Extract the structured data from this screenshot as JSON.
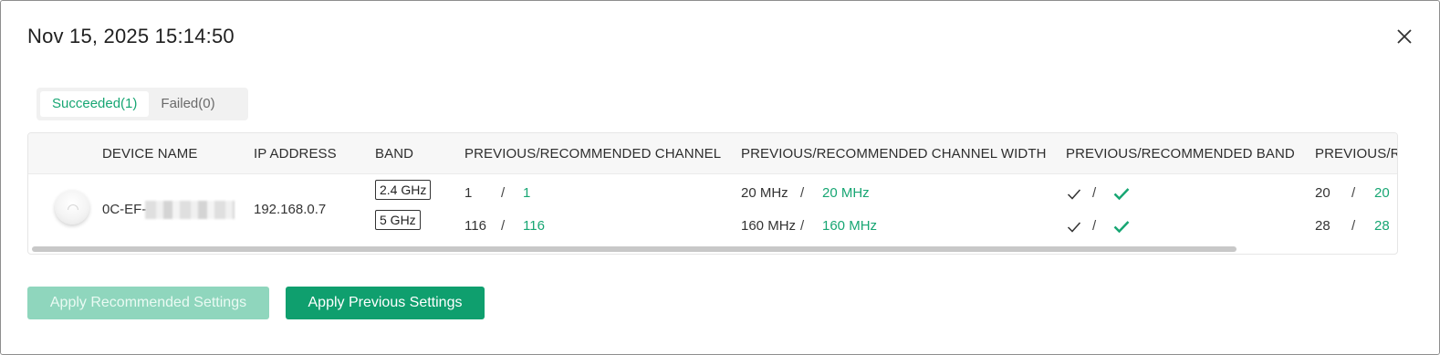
{
  "dialog": {
    "title": "Nov 15, 2025 15:14:50",
    "close_icon": "close-icon"
  },
  "tabs": [
    {
      "label": "Succeeded(1)",
      "active": true
    },
    {
      "label": "Failed(0)",
      "active": false
    }
  ],
  "table": {
    "headers": [
      "DEVICE NAME",
      "IP ADDRESS",
      "BAND",
      "PREVIOUS/RECOMMENDED CHANNEL",
      "PREVIOUS/RECOMMENDED CHANNEL WIDTH",
      "PREVIOUS/RECOMMENDED BAND",
      "PREVIOUS/R"
    ],
    "row": {
      "device_name_prefix": "0C-EF-",
      "ip_address": "192.168.0.7",
      "bands": [
        "2.4 GHz",
        "5 GHz"
      ],
      "channel": [
        {
          "previous": "1",
          "recommended": "1"
        },
        {
          "previous": "116",
          "recommended": "116"
        }
      ],
      "channel_width": [
        {
          "previous": "20 MHz",
          "recommended": "20 MHz"
        },
        {
          "previous": "160 MHz",
          "recommended": "160 MHz"
        }
      ],
      "band_status": [
        {
          "previous": "check-icon",
          "recommended": "check-icon-green"
        },
        {
          "previous": "check-icon",
          "recommended": "check-icon-green"
        }
      ],
      "last_col": [
        {
          "previous": "20",
          "recommended": "20"
        },
        {
          "previous": "28",
          "recommended": "28"
        }
      ],
      "separator": "/"
    }
  },
  "buttons": {
    "apply_recommended": "Apply Recommended Settings",
    "apply_previous": "Apply Previous Settings"
  },
  "colors": {
    "accent": "#17a673",
    "primary_button": "#0f9f6e",
    "disabled_button": "#8fd6bd"
  }
}
